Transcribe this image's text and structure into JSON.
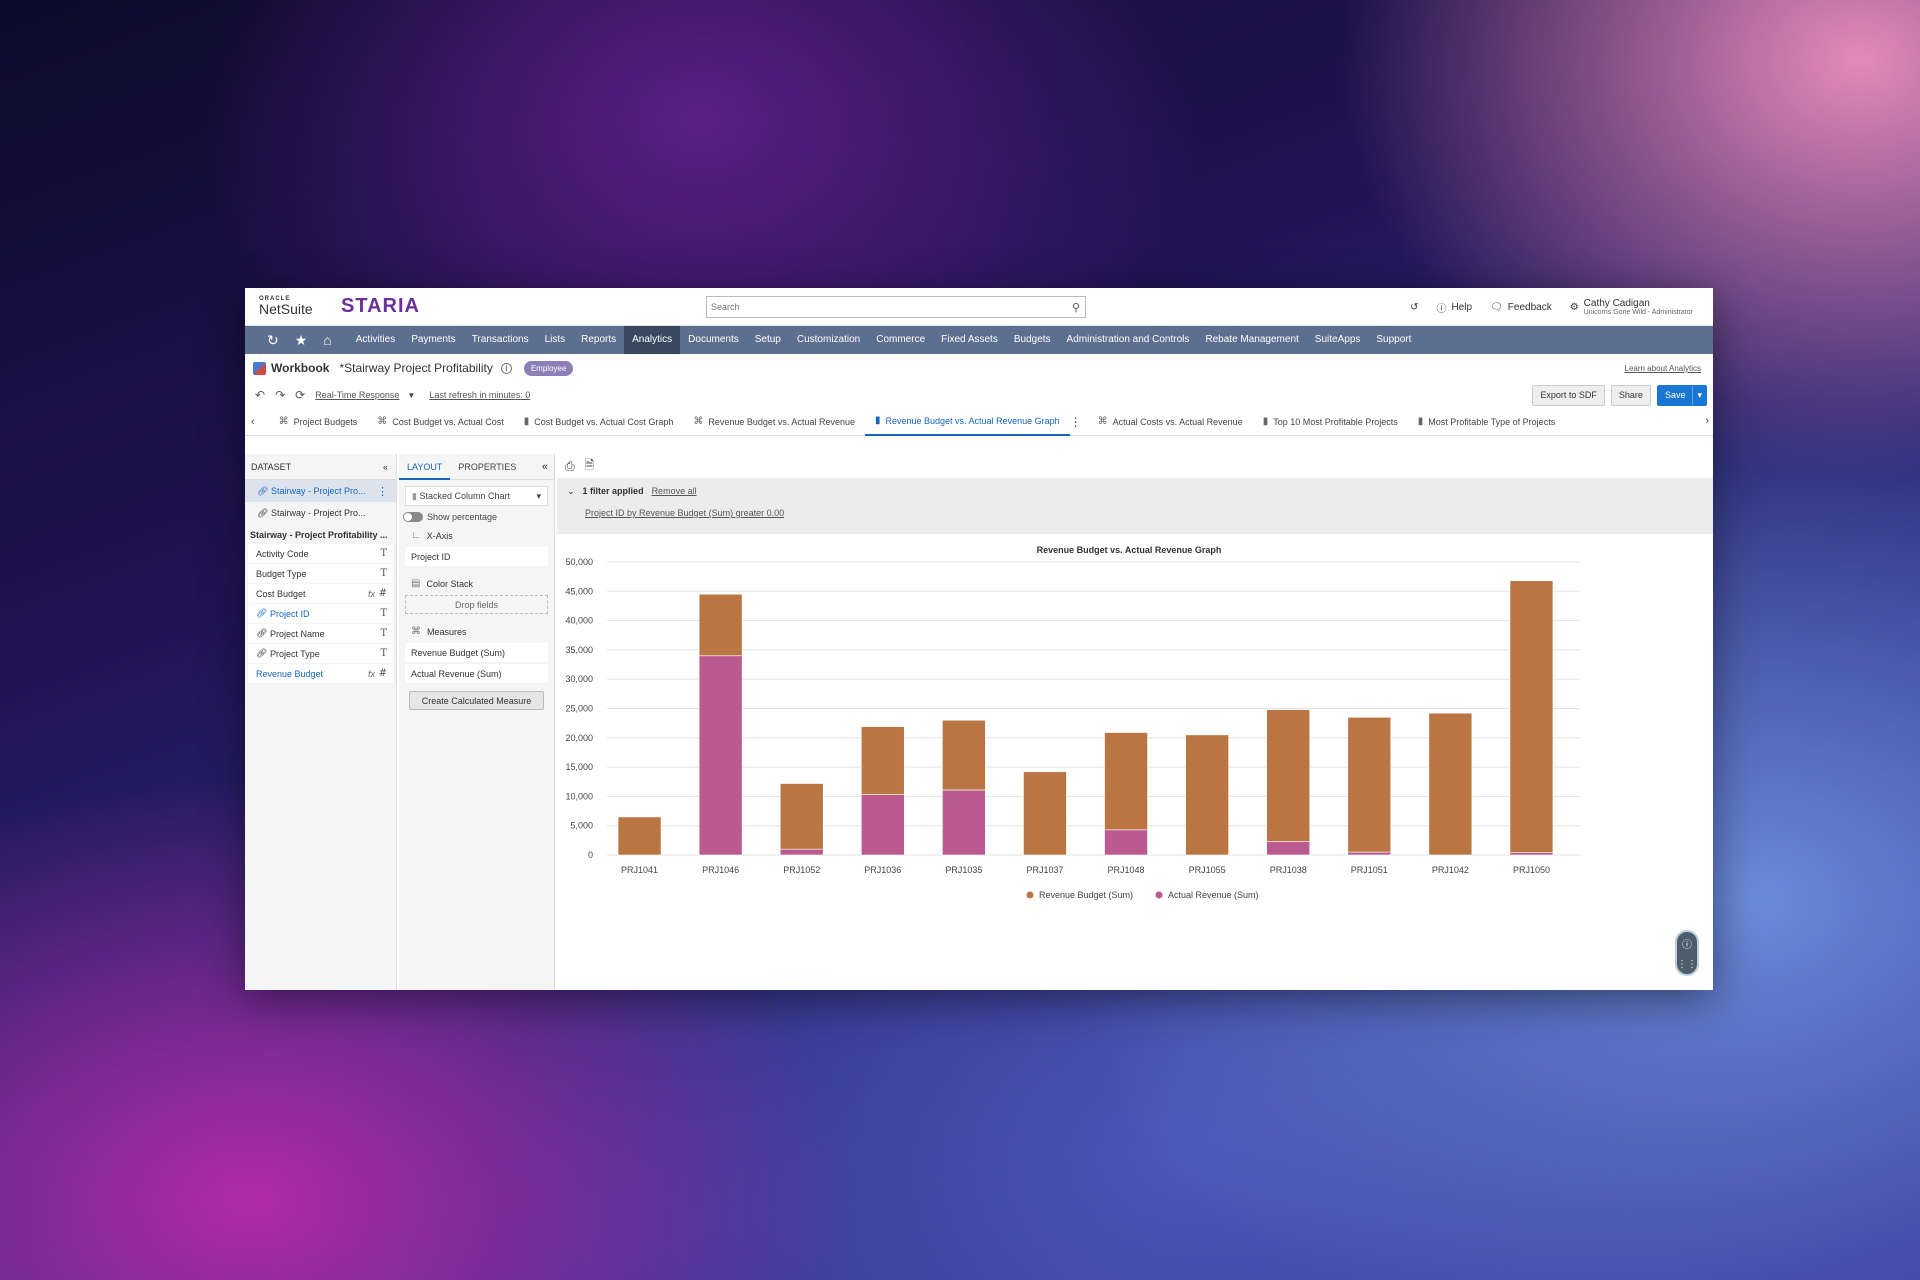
{
  "header": {
    "oracle": "ORACLE",
    "netsuite": "NetSuite",
    "brand": "STARIA",
    "search_placeholder": "Search",
    "help": "Help",
    "feedback": "Feedback",
    "user_name": "Cathy Cadigan",
    "user_role": "Unicorns Gone Wild - Administrator"
  },
  "nav": {
    "items": [
      "Activities",
      "Payments",
      "Transactions",
      "Lists",
      "Reports",
      "Analytics",
      "Documents",
      "Setup",
      "Customization",
      "Commerce",
      "Fixed Assets",
      "Budgets",
      "Administration and Controls",
      "Rebate Management",
      "SuiteApps",
      "Support"
    ],
    "active": "Analytics"
  },
  "workbook": {
    "label": "Workbook",
    "title": "*Stairway Project Profitability",
    "badge": "Employee",
    "learn": "Learn about Analytics"
  },
  "toolbar": {
    "mode": "Real-Time Response",
    "refresh": "Last refresh in minutes: 0",
    "export": "Export to SDF",
    "share": "Share",
    "save": "Save"
  },
  "tabs": [
    {
      "label": "Project Budgets",
      "kind": "pivot"
    },
    {
      "label": "Cost Budget vs. Actual Cost",
      "kind": "pivot"
    },
    {
      "label": "Cost Budget vs. Actual Cost Graph",
      "kind": "chart"
    },
    {
      "label": "Revenue Budget vs. Actual Revenue",
      "kind": "pivot"
    },
    {
      "label": "Revenue Budget vs. Actual Revenue Graph",
      "kind": "chart",
      "active": true
    },
    {
      "label": "Actual Costs vs. Actual Revenue",
      "kind": "pivot"
    },
    {
      "label": "Top 10 Most Profitable Projects",
      "kind": "chart"
    },
    {
      "label": "Most Profitable Type of Projects",
      "kind": "chart"
    }
  ],
  "dataset": {
    "header": "DATASET",
    "items": [
      "Stairway - Project Pro...",
      "Stairway - Project Pro..."
    ],
    "section": "Stairway - Project Profitability ...",
    "fields": [
      {
        "label": "Activity Code",
        "type": "T",
        "blue": false,
        "link": false,
        "fx": false
      },
      {
        "label": "Budget Type",
        "type": "T",
        "blue": false,
        "link": false,
        "fx": false
      },
      {
        "label": "Cost Budget",
        "type": "#",
        "blue": false,
        "link": false,
        "fx": true
      },
      {
        "label": "Project ID",
        "type": "T",
        "blue": true,
        "link": true,
        "fx": false
      },
      {
        "label": "Project Name",
        "type": "T",
        "blue": false,
        "link": true,
        "fx": false
      },
      {
        "label": "Project Type",
        "type": "T",
        "blue": false,
        "link": true,
        "fx": false
      },
      {
        "label": "Revenue Budget",
        "type": "#",
        "blue": true,
        "link": false,
        "fx": true
      }
    ]
  },
  "layout": {
    "tab_layout": "LAYOUT",
    "tab_properties": "PROPERTIES",
    "chart_type": "Stacked Column Chart",
    "show_percentage": "Show percentage",
    "x_axis": "X-Axis",
    "x_field": "Project ID",
    "color_stack": "Color Stack",
    "drop_fields": "Drop fields",
    "measures": "Measures",
    "measure_1": "Revenue Budget  (Sum)",
    "measure_2": "Actual Revenue  (Sum)",
    "create_btn": "Create Calculated Measure"
  },
  "filter": {
    "applied": "1 filter applied",
    "remove_all": "Remove all",
    "condition": "Project ID by Revenue Budget (Sum) greater 0.00"
  },
  "colors": {
    "revenue_budget": "#b97642",
    "actual_revenue": "#bb5a8e",
    "nav": "#5d6f8f",
    "accent": "#1565c0"
  },
  "chart_data": {
    "type": "bar",
    "stacked": true,
    "title": "Revenue Budget vs. Actual Revenue Graph",
    "categories": [
      "PRJ1041",
      "PRJ1046",
      "PRJ1052",
      "PRJ1036",
      "PRJ1035",
      "PRJ1037",
      "PRJ1048",
      "PRJ1055",
      "PRJ1038",
      "PRJ1051",
      "PRJ1042",
      "PRJ1050"
    ],
    "series": [
      {
        "name": "Actual Revenue (Sum)",
        "values": [
          0,
          34000,
          1000,
          10300,
          11100,
          0,
          4300,
          0,
          2300,
          500,
          0,
          400
        ]
      },
      {
        "name": "Revenue Budget (Sum)",
        "values": [
          6500,
          10500,
          11200,
          11600,
          11900,
          14200,
          16600,
          20500,
          22500,
          23000,
          24200,
          46400
        ]
      }
    ],
    "ylim": [
      0,
      50000
    ],
    "yticks": [
      0,
      5000,
      10000,
      15000,
      20000,
      25000,
      30000,
      35000,
      40000,
      45000,
      50000
    ],
    "ytick_labels": [
      "0",
      "5,000",
      "10,000",
      "15,000",
      "20,000",
      "25,000",
      "30,000",
      "35,000",
      "40,000",
      "45,000",
      "50,000"
    ],
    "xlabel": "",
    "ylabel": "",
    "grid": true,
    "legend": "bottom"
  }
}
